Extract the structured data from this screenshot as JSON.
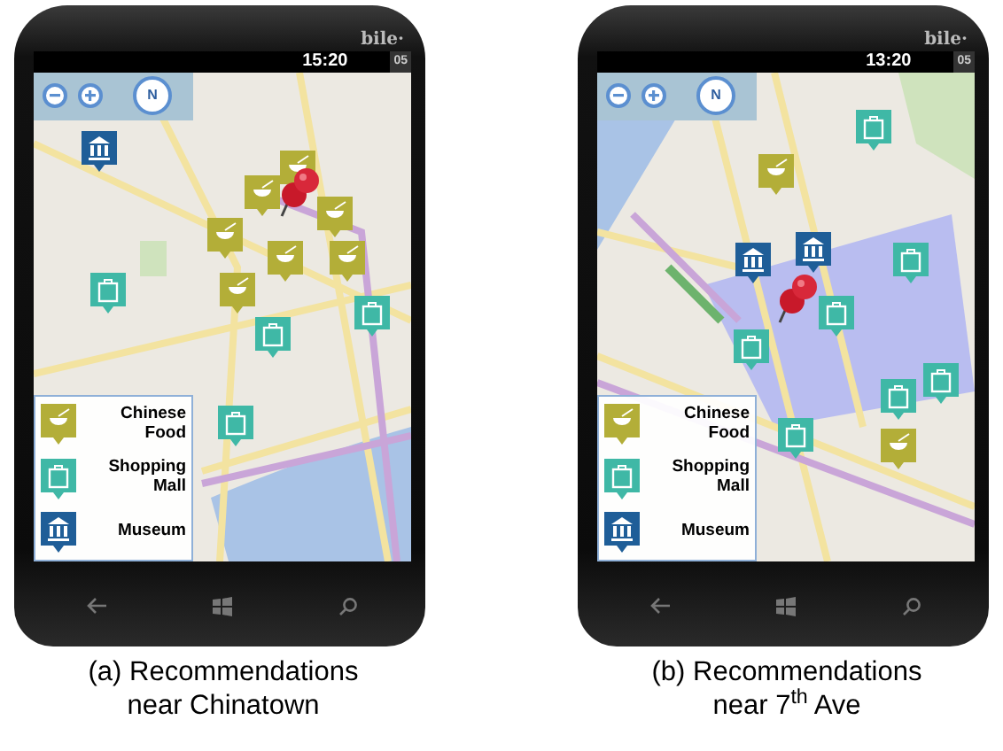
{
  "panels": [
    {
      "carrier": "bile·",
      "time": "15:20",
      "status_number": "05",
      "compass_label": "N",
      "markers": [
        {
          "kind": "museum"
        },
        {
          "kind": "food"
        },
        {
          "kind": "food"
        },
        {
          "kind": "food"
        },
        {
          "kind": "food"
        },
        {
          "kind": "food"
        },
        {
          "kind": "food"
        },
        {
          "kind": "food"
        },
        {
          "kind": "mall"
        },
        {
          "kind": "mall"
        },
        {
          "kind": "mall"
        },
        {
          "kind": "mall"
        },
        {
          "kind": "pin"
        }
      ],
      "legend": [
        {
          "kind": "food",
          "label": "Chinese Food"
        },
        {
          "kind": "mall",
          "label": "Shopping Mall"
        },
        {
          "kind": "museum",
          "label": "Museum"
        }
      ],
      "caption": "(a) Recommendations near Chinatown"
    },
    {
      "carrier": "bile·",
      "time": "13:20",
      "status_number": "05",
      "compass_label": "N",
      "markers": [
        {
          "kind": "museum"
        },
        {
          "kind": "museum"
        },
        {
          "kind": "food"
        },
        {
          "kind": "food"
        },
        {
          "kind": "mall"
        },
        {
          "kind": "mall"
        },
        {
          "kind": "mall"
        },
        {
          "kind": "mall"
        },
        {
          "kind": "mall"
        },
        {
          "kind": "mall"
        },
        {
          "kind": "mall"
        },
        {
          "kind": "pin"
        }
      ],
      "legend": [
        {
          "kind": "food",
          "label": "Chinese Food"
        },
        {
          "kind": "mall",
          "label": "Shopping Mall"
        },
        {
          "kind": "museum",
          "label": "Museum"
        }
      ],
      "caption": "(b) Recommendations near 7$^{th}$ Ave"
    }
  ]
}
